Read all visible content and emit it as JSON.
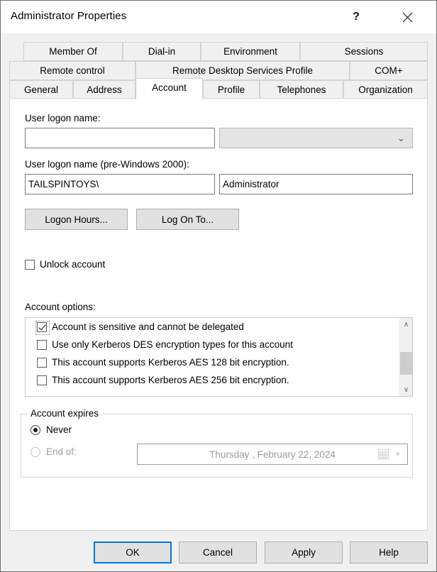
{
  "window": {
    "title": "Administrator Properties",
    "help_button": "?",
    "close_button": "✕"
  },
  "tabs": {
    "row1": [
      {
        "label": "Member Of"
      },
      {
        "label": "Dial-in"
      },
      {
        "label": "Environment"
      },
      {
        "label": "Sessions"
      }
    ],
    "row2": [
      {
        "label": "Remote control"
      },
      {
        "label": "Remote Desktop Services Profile"
      },
      {
        "label": "COM+"
      }
    ],
    "row3": [
      {
        "label": "General"
      },
      {
        "label": "Address"
      },
      {
        "label": "Account"
      },
      {
        "label": "Profile"
      },
      {
        "label": "Telephones"
      },
      {
        "label": "Organization"
      }
    ],
    "selected": "Account"
  },
  "account": {
    "user_logon_name_label": "User logon name:",
    "user_logon_name_value": "",
    "user_logon_name_placeholder": "",
    "upn_suffix_value": "",
    "upn_suffix_chevron": "⌄",
    "pre_windows_label": "User logon name (pre-Windows 2000):",
    "pre_windows_domain": "TAILSPINTOYS\\",
    "pre_windows_account": "Administrator",
    "logon_hours_button": "Logon Hours...",
    "log_on_to_button": "Log On To...",
    "unlock_account_label": "Unlock account",
    "unlock_account_checked": false,
    "account_options_label": "Account options:",
    "options": [
      {
        "label": "Account is sensitive and cannot be delegated",
        "checked": true,
        "focused": true
      },
      {
        "label": "Use only Kerberos DES encryption types for this account",
        "checked": false,
        "focused": false
      },
      {
        "label": "This account supports Kerberos AES 128 bit encryption.",
        "checked": false,
        "focused": false
      },
      {
        "label": "This account supports Kerberos AES 256 bit encryption.",
        "checked": false,
        "focused": false
      }
    ],
    "scrollbar": {
      "up_arrow": "∧",
      "down_arrow": "∨"
    },
    "account_expires": {
      "legend": "Account expires",
      "never_label": "Never",
      "never_selected": true,
      "end_of_label": "End of:",
      "end_of_selected": false,
      "end_of_enabled": false,
      "date_value": "Thursday   ,   February   22, 2024",
      "date_dropdown_arrow": "▾"
    }
  },
  "footer": {
    "ok": "OK",
    "cancel": "Cancel",
    "apply": "Apply",
    "help": "Help",
    "default_button": "OK"
  },
  "colors": {
    "accent": "#0078d7",
    "dialog_bg": "#f0f0f0",
    "panel_bg": "#ffffff",
    "border": "#d2d2d2",
    "disabled_text": "#a0a0a0"
  }
}
